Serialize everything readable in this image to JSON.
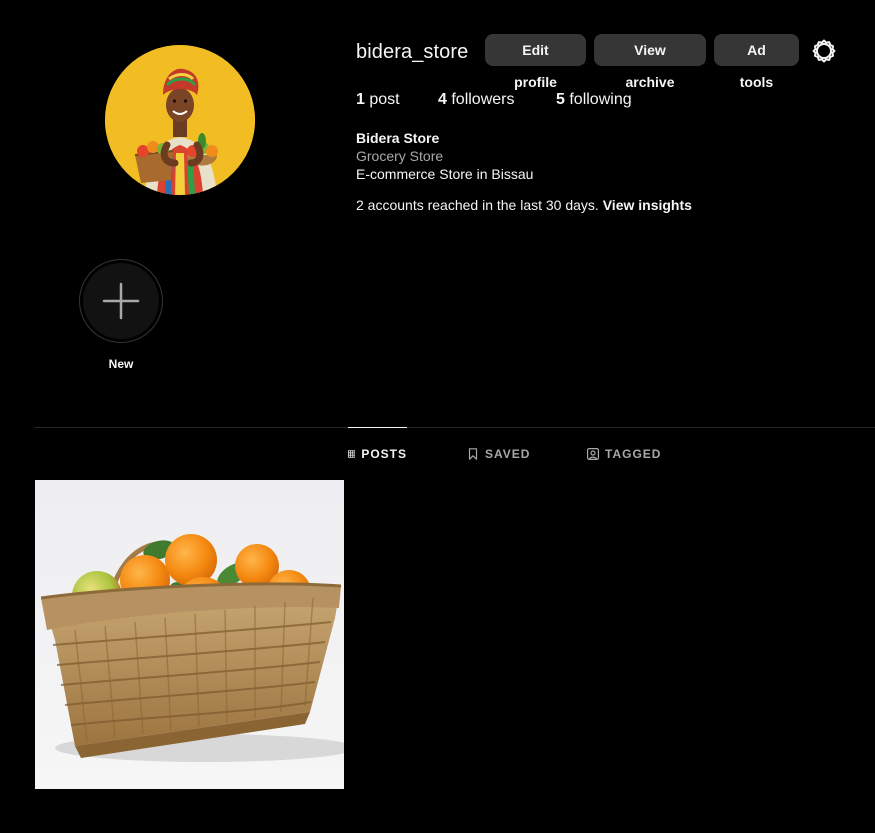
{
  "profile": {
    "username": "bidera_store",
    "avatar_alt": "Profile photo",
    "buttons": {
      "edit": "Edit profile",
      "archive": "View archive",
      "ad_tools": "Ad tools"
    },
    "settings_icon": "settings-gear-icon"
  },
  "stats": {
    "posts_count": "1",
    "posts_label": " post",
    "followers_count": "4",
    "followers_label": " followers",
    "following_count": "5",
    "following_label": " following"
  },
  "bio": {
    "name": "Bidera Store",
    "category": "Grocery Store",
    "text": "E-commerce Store in Bissau",
    "insights_text": "2 accounts reached in the last 30 days. ",
    "insights_link": "View insights"
  },
  "highlights": {
    "new_label": "New",
    "new_icon": "plus-icon"
  },
  "tabs": [
    {
      "label": "POSTS",
      "icon": "grid-icon",
      "active": true
    },
    {
      "label": "SAVED",
      "icon": "bookmark-icon",
      "active": false
    },
    {
      "label": "TAGGED",
      "icon": "tagged-user-icon",
      "active": false
    }
  ],
  "posts": [
    {
      "image": "basket-of-oranges"
    }
  ],
  "colors": {
    "background": "#000000",
    "button_bg": "#363636",
    "text_primary": "#f5f5f5",
    "text_secondary": "#a8a8a8",
    "divider": "#262626"
  }
}
